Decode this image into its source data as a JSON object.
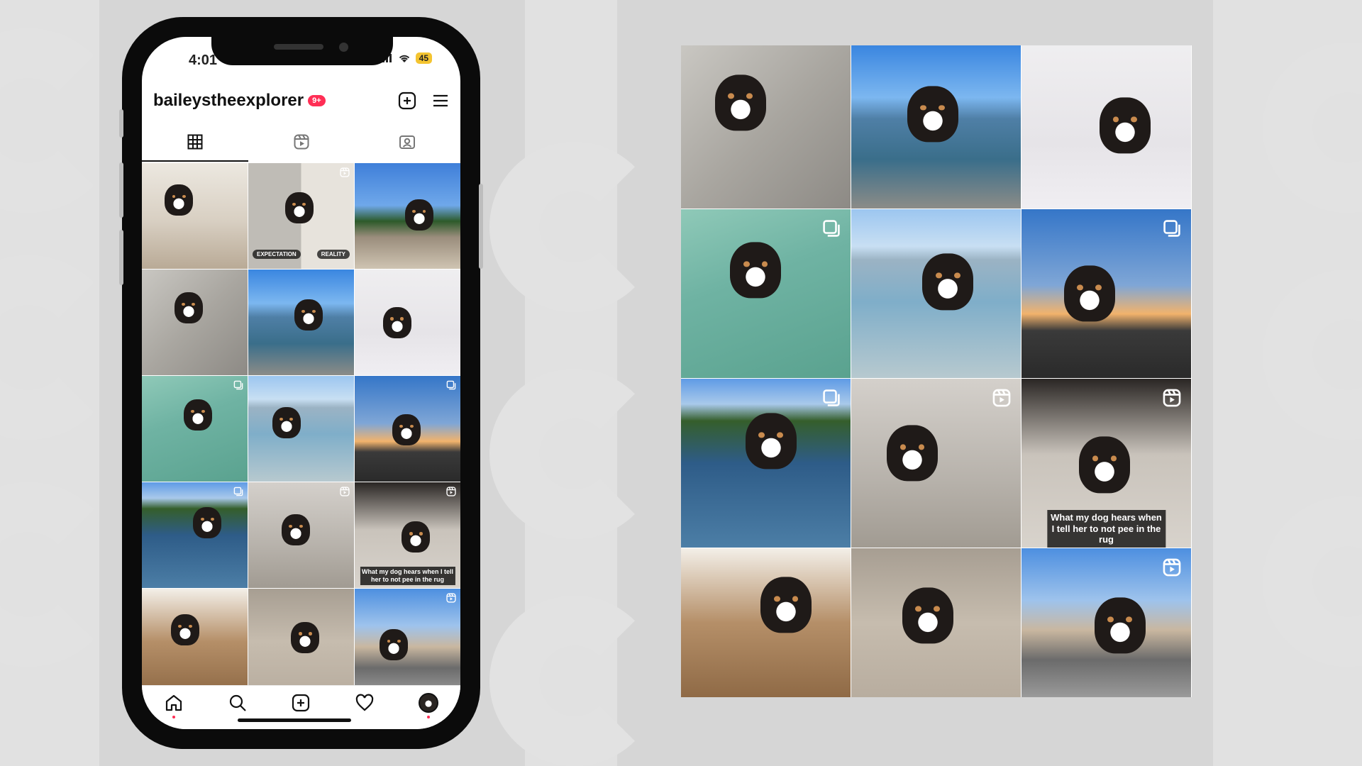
{
  "status_bar": {
    "time": "4:01",
    "battery": "45"
  },
  "profile": {
    "username": "baileystheexplorer",
    "notification_badge": "9+"
  },
  "phone_grid": [
    {
      "style": "t-dog-floor",
      "overlay": "",
      "caption": ""
    },
    {
      "style": "t-split",
      "overlay": "reel-icon",
      "caption": "",
      "tag_left": "EXPECTATION",
      "tag_right": "REALITY"
    },
    {
      "style": "t-dock",
      "overlay": "",
      "caption": ""
    },
    {
      "style": "t-concrete",
      "overlay": "",
      "caption": ""
    },
    {
      "style": "t-beach",
      "overlay": "",
      "caption": ""
    },
    {
      "style": "t-party",
      "overlay": "",
      "caption": ""
    },
    {
      "style": "t-swim",
      "overlay": "carousel-icon",
      "caption": ""
    },
    {
      "style": "t-city",
      "overlay": "",
      "caption": ""
    },
    {
      "style": "t-sunset",
      "overlay": "carousel-icon",
      "caption": ""
    },
    {
      "style": "t-lake",
      "overlay": "carousel-icon",
      "caption": ""
    },
    {
      "style": "t-bunny",
      "overlay": "reel-icon",
      "caption": ""
    },
    {
      "style": "t-rug",
      "overlay": "reel-icon",
      "caption": "What my dog hears when I tell her to not pee in the rug"
    },
    {
      "style": "t-ice",
      "overlay": "",
      "caption": ""
    },
    {
      "style": "t-sand",
      "overlay": "",
      "caption": ""
    },
    {
      "style": "t-church",
      "overlay": "reel-icon",
      "caption": ""
    }
  ],
  "large_grid": [
    {
      "style": "t-concrete",
      "overlay": "",
      "caption": ""
    },
    {
      "style": "t-beach",
      "overlay": "",
      "caption": ""
    },
    {
      "style": "t-party",
      "overlay": "",
      "caption": ""
    },
    {
      "style": "t-swim",
      "overlay": "carousel-icon",
      "caption": ""
    },
    {
      "style": "t-city",
      "overlay": "",
      "caption": ""
    },
    {
      "style": "t-sunset",
      "overlay": "carousel-icon",
      "caption": ""
    },
    {
      "style": "t-lake",
      "overlay": "carousel-icon",
      "caption": ""
    },
    {
      "style": "t-bunny",
      "overlay": "reel-icon",
      "caption": ""
    },
    {
      "style": "t-rug",
      "overlay": "reel-icon",
      "caption": "What my dog hears when I tell her to not pee in the rug"
    },
    {
      "style": "t-ice",
      "overlay": "",
      "caption": ""
    },
    {
      "style": "t-sand",
      "overlay": "",
      "caption": ""
    },
    {
      "style": "t-church",
      "overlay": "reel-icon",
      "caption": ""
    }
  ],
  "colors": {
    "background": "#d6d6d6",
    "badge": "#ff2e55",
    "phone_frame": "#0b0b0b"
  }
}
